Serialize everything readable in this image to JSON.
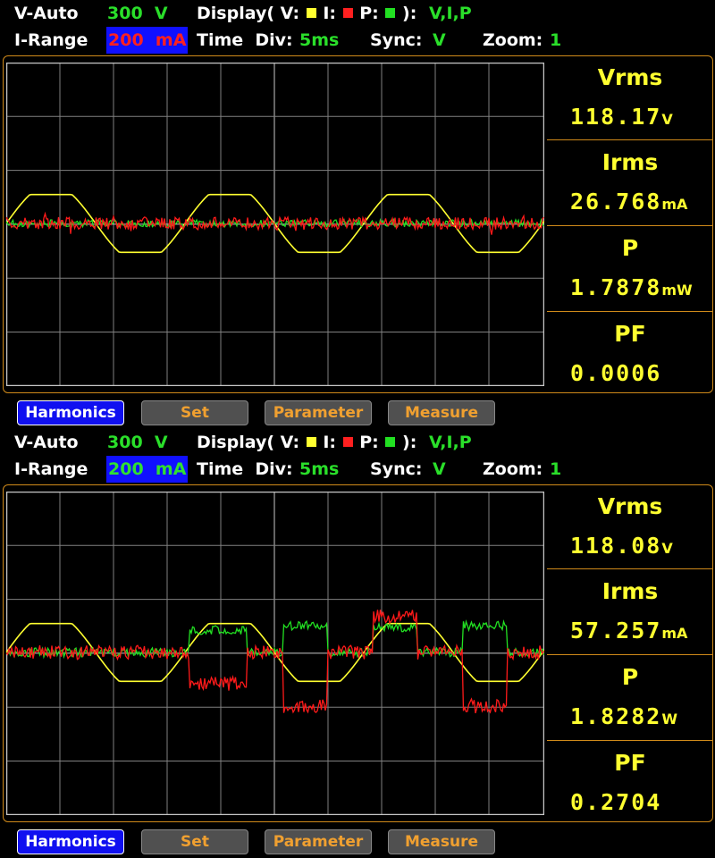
{
  "panels": [
    {
      "status": {
        "v_mode": "V-Auto",
        "v_range": "300  V",
        "display_label": "Display( V:",
        "i_label": "I:",
        "p_label": "P:",
        "display_close": "):",
        "display_value": "V,I,P",
        "i_range_label": "I-Range",
        "i_range_value": "200  mA",
        "time_div_label": "Time  Div:",
        "time_div_value": "5ms",
        "sync_label": "Sync:",
        "sync_value": "V",
        "zoom_label": "Zoom:",
        "zoom_value": "1"
      },
      "measurements": [
        {
          "label": "Vrms",
          "value": "118.17",
          "unit": "V"
        },
        {
          "label": "Irms",
          "value": "26.768",
          "unit": "mA"
        },
        {
          "label": "P",
          "value": "1.7878",
          "unit": "mW"
        },
        {
          "label": "PF",
          "value": "0.0006",
          "unit": ""
        }
      ],
      "buttons": [
        "Harmonics",
        "Set",
        "Parameter",
        "Measure"
      ]
    },
    {
      "status": {
        "v_mode": "V-Auto",
        "v_range": "300  V",
        "display_label": "Display( V:",
        "i_label": "I:",
        "p_label": "P:",
        "display_close": "):",
        "display_value": "V,I,P",
        "i_range_label": "I-Range",
        "i_range_value": "200  mA",
        "time_div_label": "Time  Div:",
        "time_div_value": "5ms",
        "sync_label": "Sync:",
        "sync_value": "V",
        "zoom_label": "Zoom:",
        "zoom_value": "1"
      },
      "measurements": [
        {
          "label": "Vrms",
          "value": "118.08",
          "unit": "V"
        },
        {
          "label": "Irms",
          "value": "57.257",
          "unit": "mA"
        },
        {
          "label": "P",
          "value": "1.8282",
          "unit": "W"
        },
        {
          "label": "PF",
          "value": "0.2704",
          "unit": ""
        }
      ],
      "buttons": [
        "Harmonics",
        "Set",
        "Parameter",
        "Measure"
      ]
    }
  ],
  "colors": {
    "voltage": "#ffff30",
    "current": "#ff1a1a",
    "power": "#22e022",
    "grid": "#808080",
    "frame": "#d08a1a"
  }
}
